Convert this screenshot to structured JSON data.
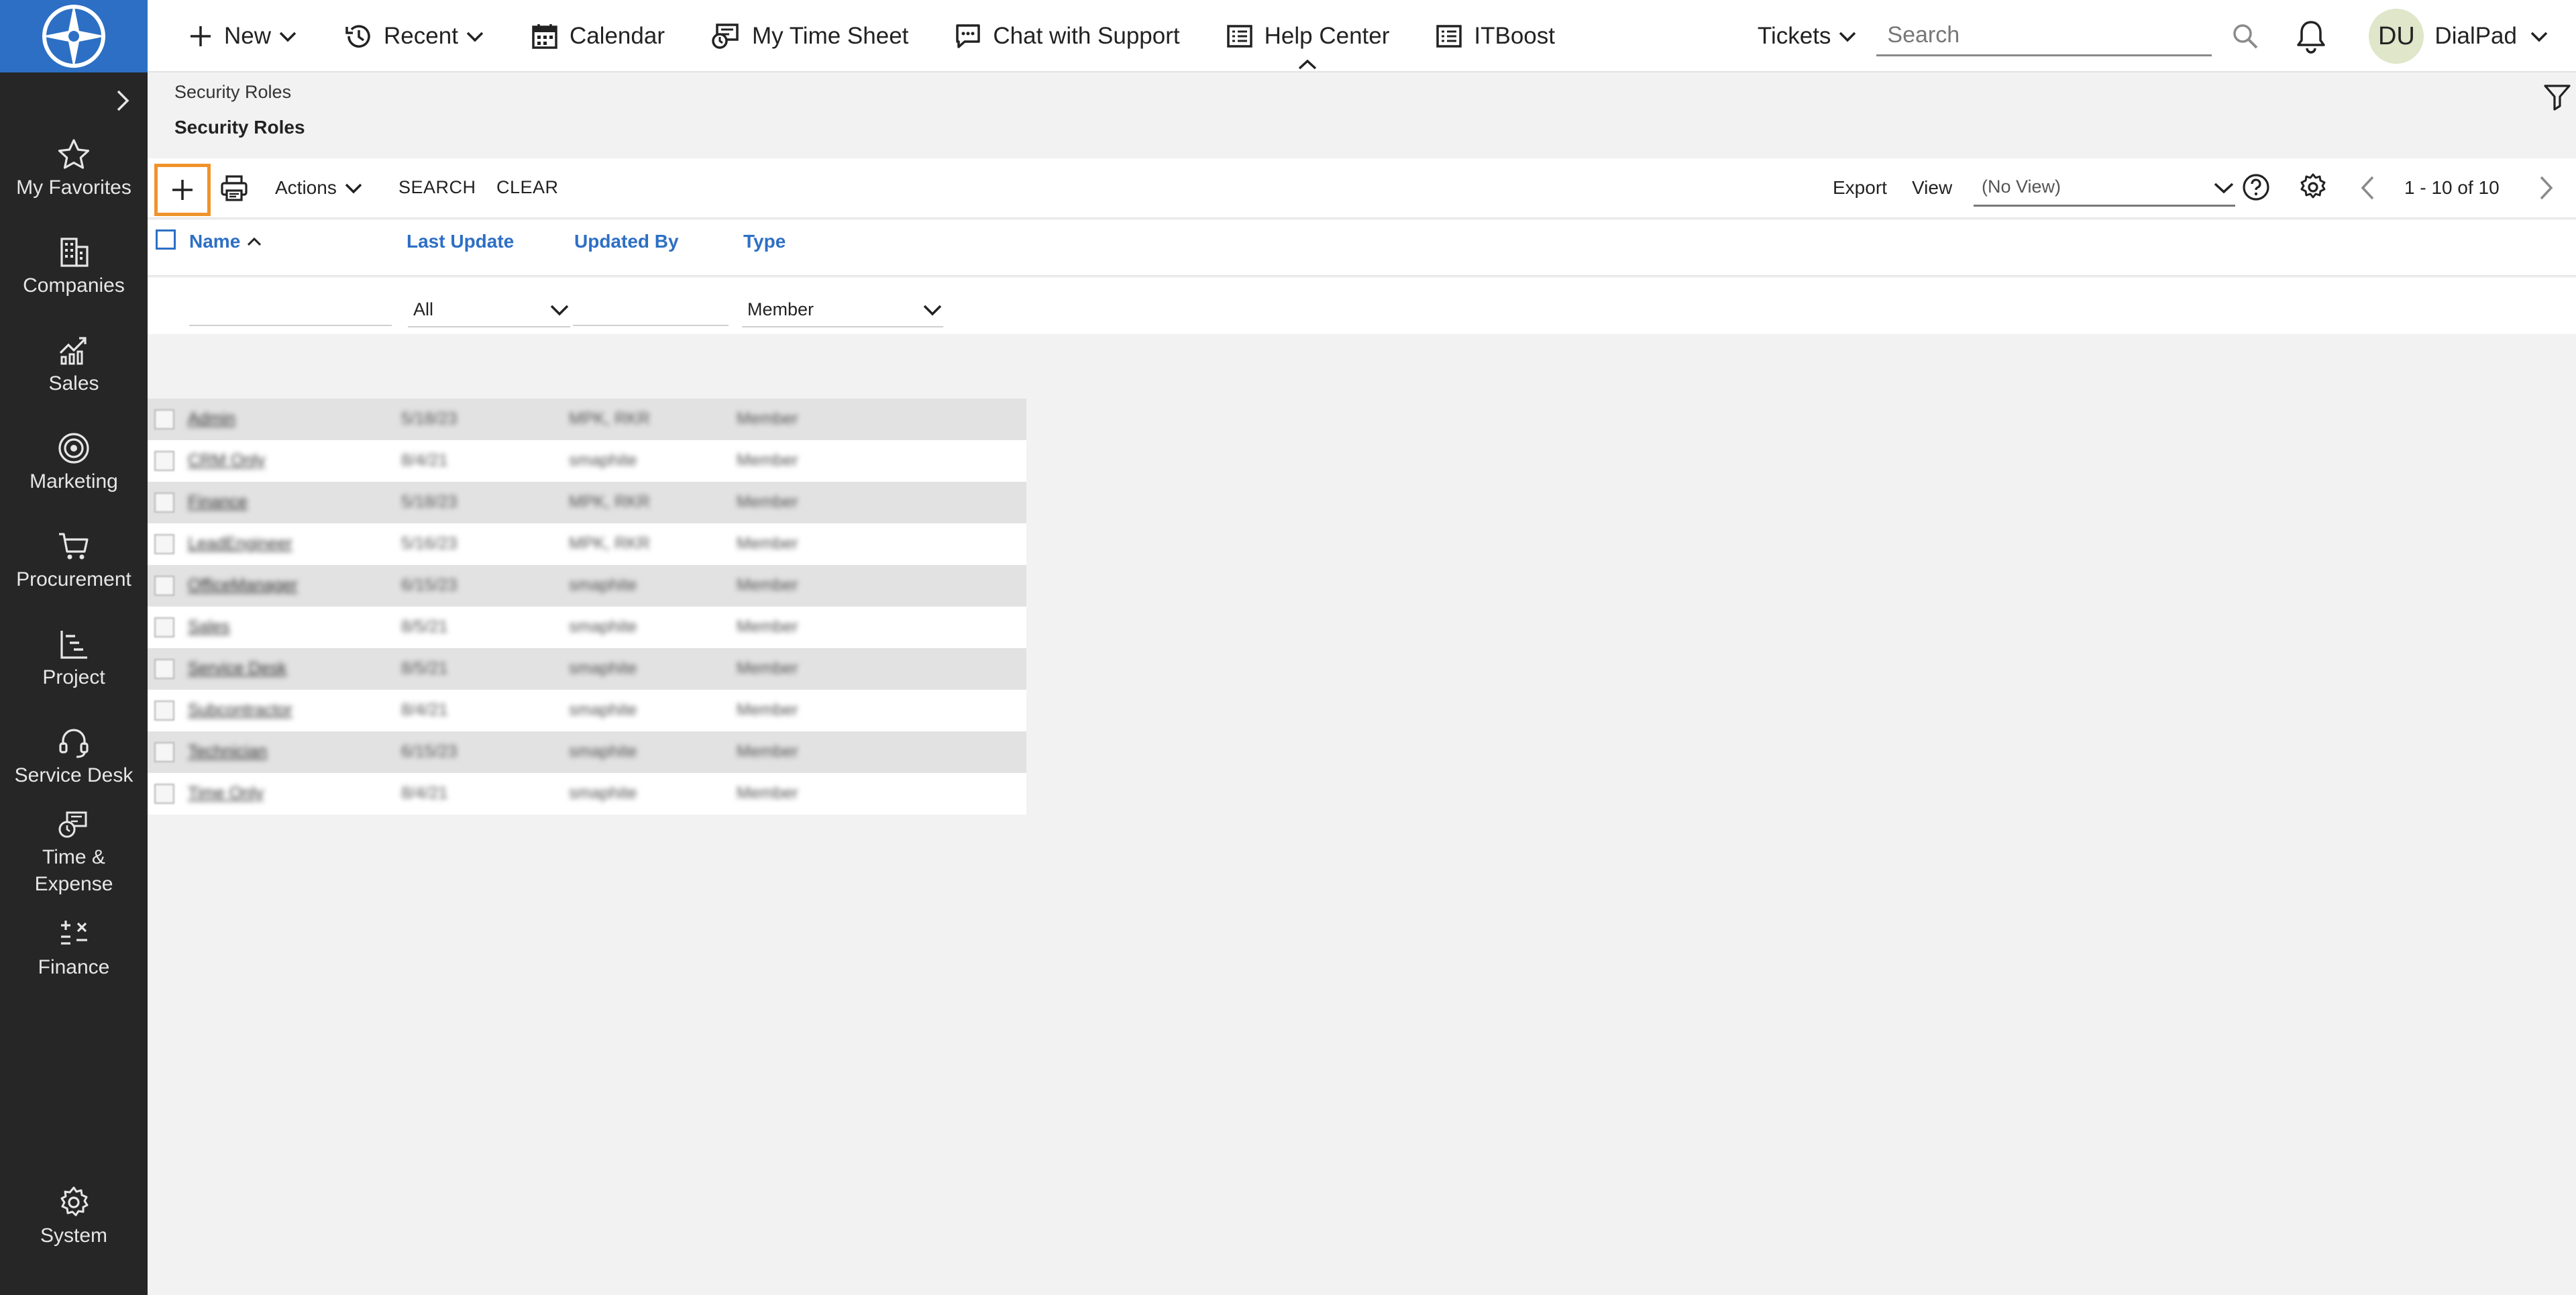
{
  "topbar": {
    "nav": [
      {
        "label": "New",
        "icon": "plus-icon",
        "dropdown": true
      },
      {
        "label": "Recent",
        "icon": "history-icon",
        "dropdown": true
      },
      {
        "label": "Calendar",
        "icon": "calendar-icon",
        "dropdown": false
      },
      {
        "label": "My Time Sheet",
        "icon": "timesheet-icon",
        "dropdown": false
      },
      {
        "label": "Chat with Support",
        "icon": "chat-icon",
        "dropdown": false
      },
      {
        "label": "Help Center",
        "icon": "help-center-icon",
        "dropdown": false
      },
      {
        "label": "ITBoost",
        "icon": "itboost-icon",
        "dropdown": false
      }
    ],
    "tickets_label": "Tickets",
    "search_placeholder": "Search",
    "avatar_initials": "DU",
    "user_name": "DialPad"
  },
  "sidebar": {
    "items": [
      {
        "label": "My Favorites",
        "icon": "star-icon"
      },
      {
        "label": "Companies",
        "icon": "building-icon"
      },
      {
        "label": "Sales",
        "icon": "sales-chart-icon"
      },
      {
        "label": "Marketing",
        "icon": "target-icon"
      },
      {
        "label": "Procurement",
        "icon": "cart-icon"
      },
      {
        "label": "Project",
        "icon": "project-icon"
      },
      {
        "label": "Service Desk",
        "icon": "headset-icon"
      },
      {
        "label": "Time &\nExpense",
        "icon": "time-expense-icon"
      },
      {
        "label": "Finance",
        "icon": "finance-icon"
      },
      {
        "label": "System",
        "icon": "gear-icon"
      }
    ]
  },
  "page": {
    "breadcrumb": "Security Roles",
    "title": "Security Roles"
  },
  "toolbar": {
    "actions_label": "Actions",
    "search_label": "SEARCH",
    "clear_label": "CLEAR",
    "export_label": "Export",
    "view_label": "View",
    "view_value": "(No View)",
    "pager": "1 - 10 of 10"
  },
  "table": {
    "columns": [
      "Name",
      "Last Update",
      "Updated By",
      "Type"
    ],
    "filters": {
      "last_update": "All",
      "type": "Member"
    },
    "rows": [
      {
        "name": "Admin",
        "last_update": "5/18/23",
        "updated_by": "MPK, RKR",
        "type": "Member"
      },
      {
        "name": "CRM Only",
        "last_update": "8/4/21",
        "updated_by": "smaphite",
        "type": "Member"
      },
      {
        "name": "Finance",
        "last_update": "5/18/23",
        "updated_by": "MPK, RKR",
        "type": "Member"
      },
      {
        "name": "LeadEngineer",
        "last_update": "5/16/23",
        "updated_by": "MPK, RKR",
        "type": "Member"
      },
      {
        "name": "OfficeManager",
        "last_update": "6/15/23",
        "updated_by": "smaphite",
        "type": "Member"
      },
      {
        "name": "Sales",
        "last_update": "8/5/21",
        "updated_by": "smaphite",
        "type": "Member"
      },
      {
        "name": "Service Desk",
        "last_update": "8/5/21",
        "updated_by": "smaphite",
        "type": "Member"
      },
      {
        "name": "Subcontractor",
        "last_update": "8/4/21",
        "updated_by": "smaphite",
        "type": "Member"
      },
      {
        "name": "Technician",
        "last_update": "6/15/23",
        "updated_by": "smaphite",
        "type": "Member"
      },
      {
        "name": "Time Only",
        "last_update": "8/4/21",
        "updated_by": "smaphite",
        "type": "Member"
      }
    ]
  }
}
